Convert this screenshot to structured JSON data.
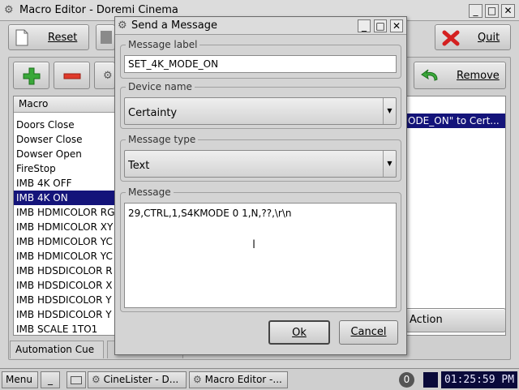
{
  "window": {
    "title": "Macro Editor - Doremi Cinema",
    "buttons": [
      "_",
      "□",
      "✕"
    ]
  },
  "toolbar": {
    "reset_label": "Reset",
    "quit_label": "Quit",
    "remove_label": "Remove",
    "action_label": "Action"
  },
  "macro_list": {
    "header": "Macro",
    "items": [
      "Doors Close",
      "Dowser Close",
      "Dowser Open",
      "FireStop",
      "IMB 4K OFF",
      "IMB 4K ON",
      "IMB HDMICOLOR RG",
      "IMB HDMICOLOR XY",
      "IMB HDMICOLOR YC",
      "IMB HDMICOLOR YC",
      "IMB HDSDICOLOR R",
      "IMB HDSDICOLOR X",
      "IMB HDSDICOLOR Y",
      "IMB HDSDICOLOR Y",
      "IMB SCALE 1TO1"
    ],
    "selected_index": 5
  },
  "right_list": {
    "selected_text": "ODE_ON\" to Cert..."
  },
  "tabs": {
    "automation_cue": "Automation Cue"
  },
  "dialog": {
    "title": "Send a Message",
    "buttons": [
      "_",
      "□",
      "✕"
    ],
    "message_label": {
      "legend": "Message label",
      "value": "SET_4K_MODE_ON"
    },
    "device_name": {
      "legend": "Device name",
      "value": "Certainty"
    },
    "message_type": {
      "legend": "Message type",
      "value": "Text"
    },
    "message": {
      "legend": "Message",
      "value": "29,CTRL,1,S4KMODE 0 1,N,??,\\r\\n"
    },
    "ok_label": "Ok",
    "cancel_label": "Cancel"
  },
  "taskbar": {
    "menu_label": "Menu",
    "minimize_label": "_",
    "task1": "CineLister - D...",
    "task2": "Macro Editor -...",
    "badge": "0",
    "clock": "01:25:59 PM"
  },
  "colors": {
    "selection": "#14147a",
    "plus_green": "#3aa83a",
    "minus_red": "#e03a2a",
    "quit_red": "#d42020",
    "clock_bg": "#0a0a3a"
  },
  "icons": {
    "window_icon": "gear-icon",
    "reset_icon": "document-icon",
    "quit_icon": "red-x-icon",
    "add_icon": "plus-icon",
    "remove_icon": "minus-icon",
    "remove_entry_icon": "green-arrow-icon"
  }
}
